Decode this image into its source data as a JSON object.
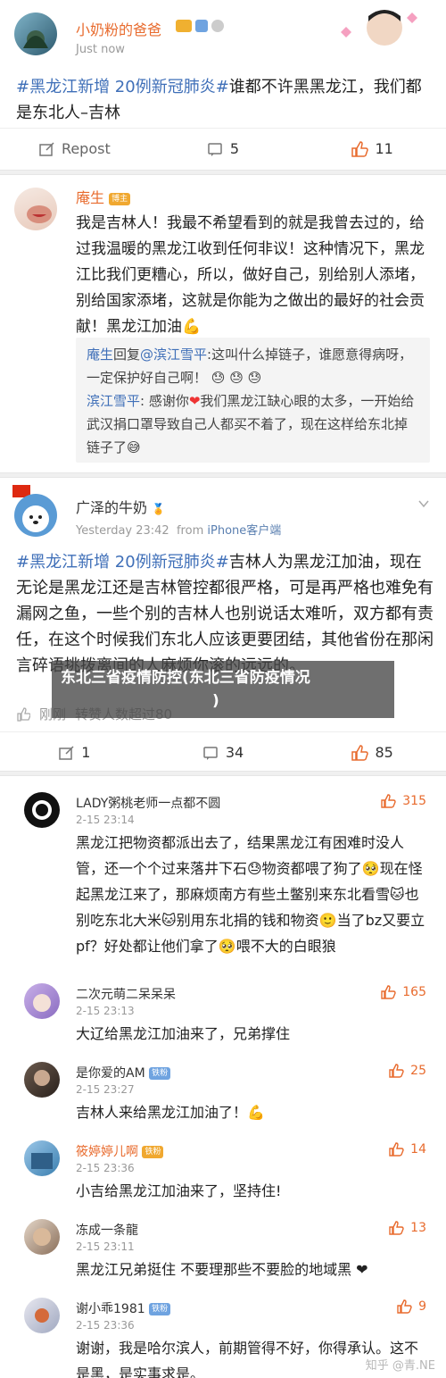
{
  "post1": {
    "username": "小奶粉的爸爸",
    "time": "Just now",
    "text_tag": "#黑龙江新增 20例新冠肺炎#",
    "text": "谁都不许黑黑龙江，我们都是东北人–吉林",
    "repost_label": "Repost",
    "comments": "5",
    "likes": "11"
  },
  "post2": {
    "username": "庵生",
    "badge": "博主",
    "text": "我是吉林人！我最不希望看到的就是我曾去过的，给过我温暖的黑龙江收到任何非议！这种情况下，黑龙江比我们更糟心，所以，做好自己，别给别人添堵，别给国家添堵，这就是你能为之做出的最好的社会贡献！黑龙江加油",
    "reply1_from": "庵生",
    "reply1_mid": "回复",
    "reply1_to": "@滨江雪平",
    "reply1_text": ":这叫什么掉链子，谁愿意得病呀，一定保护好自己啊！",
    "reply2_from": "滨江雪平",
    "reply2_text": ": 感谢你",
    "reply2_text2": "我们黑龙江缺心眼的太多，一开始给武汉捐口罩导致自己人都买不着了，现在这样给东北掉链子了"
  },
  "post3": {
    "username": "广泽的牛奶",
    "time": "Yesterday 23:42",
    "source_prefix": "from",
    "source": "iPhone客户端",
    "text_tag": "#黑龙江新增 20例新冠肺炎#",
    "text": "吉林人为黑龙江加油，现在无论是黑龙江还是吉林管控都很严格，可是再严格也难免有漏网之鱼，一些个别的吉林人也别说话太难听，双方都有责任，在这个时候我们东北人应该更要团结，其他省份在那闲言碎语挑拨离间的人麻烦你滚的远远的。",
    "liked_note1": "刚刚",
    "liked_note2": "转赞人数超过80",
    "reposts": "1",
    "comments": "34",
    "likes": "85"
  },
  "overlay": {
    "line1": "东北三省疫情防控(东北三省防疫情况",
    "line2": ")"
  },
  "comments": [
    {
      "name": "LADY粥桃老师一点都不圆",
      "time": "2-15 23:14",
      "likes": "315",
      "text": "黑龙江把物资都派出去了，结果黑龙江有困难时没人管，还一个个过来落井下石😓物资都喂了狗了🥺现在怪起黑龙江来了，那麻烦南方有些土鳖别来东北看雪🐱也别吃东北大米🐱别用东北捐的钱和物资🙂当了bz又要立pf？好处都让他们拿了🥺喂不大的白眼狼"
    },
    {
      "name": "二次元萌二呆呆呆",
      "time": "2-15 23:13",
      "likes": "165",
      "text": "大辽给黑龙江加油来了，兄弟撑住"
    },
    {
      "name": "是你爱的AM",
      "badge": "铁粉",
      "time": "2-15 23:27",
      "likes": "25",
      "text": "吉林人来给黑龙江加油了！💪"
    },
    {
      "name": "筱婷婷儿啊",
      "badge": "铁粉",
      "time": "2-15 23:36",
      "likes": "14",
      "text": "小吉给黑龙江加油来了，坚持住!"
    },
    {
      "name": "冻成一条龍",
      "time": "2-15 23:11",
      "likes": "13",
      "text": "黑龙江兄弟挺住  不要理那些不要脸的地域黑   ❤"
    },
    {
      "name": "谢小乖1981",
      "badge": "铁粉",
      "time": "2-15 23:36",
      "likes": "9",
      "text": "谢谢，我是哈尔滨人，前期管得不好，你得承认。这不是黑，是实事求是。"
    }
  ],
  "watermark": "知乎 @青.NE"
}
